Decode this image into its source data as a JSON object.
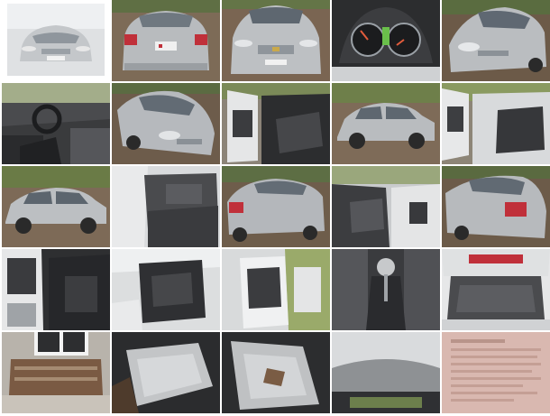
{
  "gallery": {
    "items": [
      {
        "subject": "car-front-studio",
        "selected": true
      },
      {
        "subject": "car-rear"
      },
      {
        "subject": "car-front"
      },
      {
        "subject": "instrument-cluster"
      },
      {
        "subject": "car-front-angle"
      },
      {
        "subject": "interior-dashboard"
      },
      {
        "subject": "car-front-left-angle"
      },
      {
        "subject": "door-open-interior"
      },
      {
        "subject": "car-side"
      },
      {
        "subject": "open-door-rear-seat"
      },
      {
        "subject": "car-side-left"
      },
      {
        "subject": "rear-seat-interior"
      },
      {
        "subject": "car-rear-angle"
      },
      {
        "subject": "front-seat-interior"
      },
      {
        "subject": "car-rear-right-angle"
      },
      {
        "subject": "door-panel-interior"
      },
      {
        "subject": "door-open-front-seat"
      },
      {
        "subject": "door-open-side"
      },
      {
        "subject": "gear-shifter"
      },
      {
        "subject": "trunk-open"
      },
      {
        "subject": "house-window"
      },
      {
        "subject": "seat-cushion"
      },
      {
        "subject": "seat-cushion-closeup"
      },
      {
        "subject": "roof-interior"
      },
      {
        "subject": "document-page"
      }
    ]
  },
  "colors": {
    "silver_car": "#b9bcbf",
    "grass": "#6e7f4a",
    "dirt": "#7a6552",
    "interior_dark": "#2f2f30",
    "taillight": "#c0303a",
    "document": "#d9b8b0"
  }
}
